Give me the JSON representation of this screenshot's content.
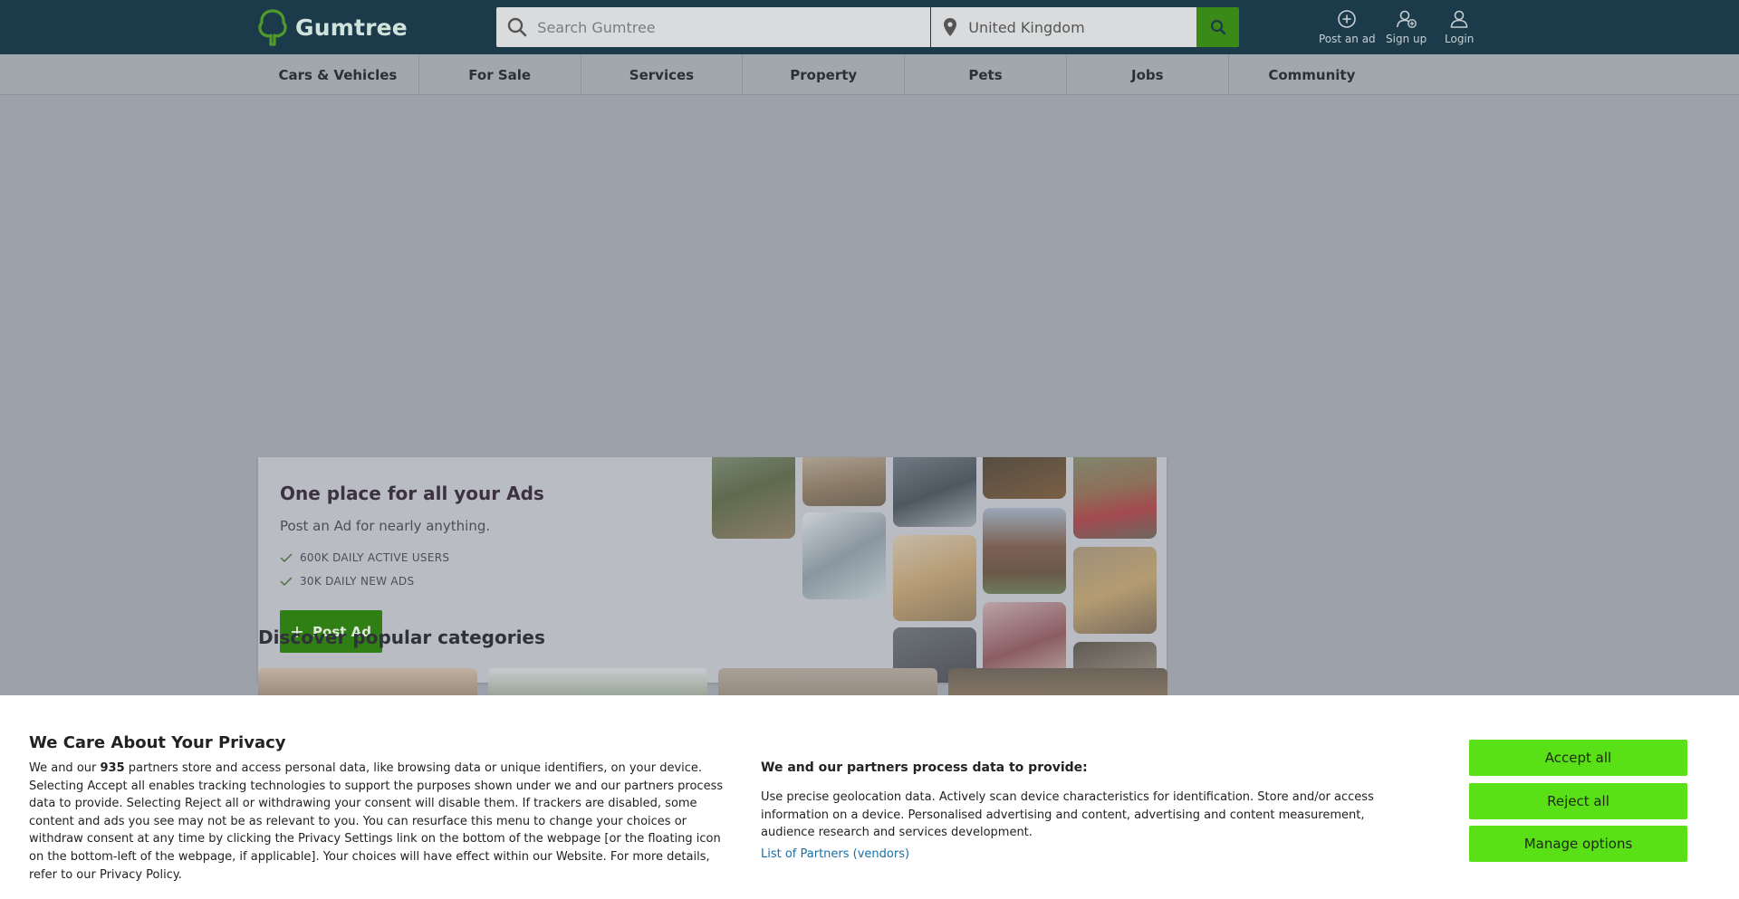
{
  "header": {
    "logo_text": "Gumtree",
    "search_placeholder": "Search Gumtree",
    "location_value": "United Kingdom",
    "actions": [
      {
        "label": "Post an ad",
        "icon": "plus-circle-icon"
      },
      {
        "label": "Sign up",
        "icon": "user-plus-icon"
      },
      {
        "label": "Login",
        "icon": "user-icon"
      }
    ]
  },
  "categories": [
    "Cars & Vehicles",
    "For Sale",
    "Services",
    "Property",
    "Pets",
    "Jobs",
    "Community"
  ],
  "hero": {
    "title": "One place for all your Ads",
    "subtitle": "Post an Ad for nearly anything.",
    "features": [
      "600K DAILY ACTIVE USERS",
      "30K DAILY NEW ADS"
    ],
    "post_button": "Post Ad"
  },
  "discover_title": "Discover popular categories",
  "consent": {
    "title": "We Care About Your Privacy",
    "text_before_count": "We and our ",
    "partner_count": "935",
    "text_after_count": " partners store and access personal data, like browsing data or unique identifiers, on your device. Selecting Accept all enables tracking technologies to support the purposes shown under we and our partners process data to provide. Selecting Reject all or withdrawing your consent will disable them. If trackers are disabled, some content and ads you see may not be as relevant to you. You can resurface this menu to change your choices or withdraw consent at any time by clicking the Privacy Settings link on the bottom of the webpage [or the floating icon on the bottom-left of the webpage, if applicable]. Your choices will have effect within our Website. For more details, refer to our Privacy Policy.",
    "purposes_title": "We and our partners process data to provide:",
    "purposes_text": "Use precise geolocation data. Actively scan device characteristics for identification. Store and/or access information on a device. Personalised advertising and content, advertising and content measurement, audience research and services development.",
    "vendors_link": "List of Partners (vendors)",
    "accept_all": "Accept all",
    "reject_all": "Reject all",
    "manage_options": "Manage options"
  },
  "colors": {
    "header_bg": "#1c3b4a",
    "brand_green": "#5ae016",
    "overlay_bg": "#9da2aa",
    "link": "#1a6fa6"
  }
}
